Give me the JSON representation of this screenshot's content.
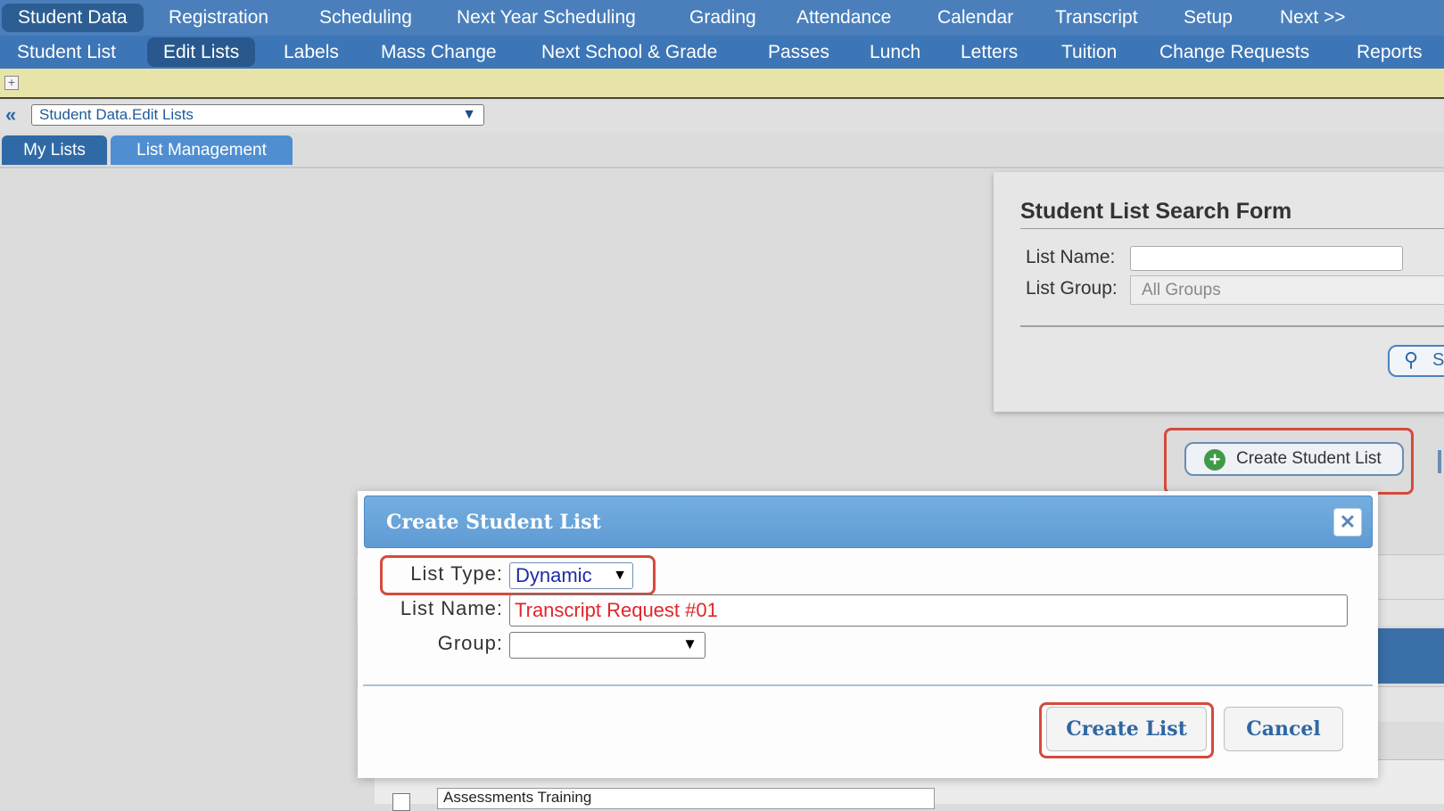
{
  "top_nav": {
    "items": [
      "Student Data",
      "Registration",
      "Scheduling",
      "Next Year Scheduling",
      "Grading",
      "Attendance",
      "Calendar",
      "Transcript",
      "Setup",
      "Next >>"
    ]
  },
  "sub_nav": {
    "items": [
      "Student List",
      "Edit Lists",
      "Labels",
      "Mass Change",
      "Next School & Grade",
      "Passes",
      "Lunch",
      "Letters",
      "Tuition",
      "Change Requests",
      "Reports"
    ]
  },
  "breadcrumb": {
    "icon": "double-chevron-left-icon",
    "select_value": "Student Data.Edit Lists"
  },
  "tabs": [
    "My Lists",
    "List Management"
  ],
  "search_form": {
    "title": "Student List Search Form",
    "list_name_label": "List Name:",
    "list_name_value": "",
    "list_group_label": "List Group:",
    "list_group_value": "All Groups",
    "search_icon": "search-icon",
    "search_label_partial": "S"
  },
  "create_button": {
    "label": "Create Student List",
    "icon": "plus-circle-icon"
  },
  "dialog": {
    "title": "Create Student List",
    "close_icon": "close-icon",
    "list_type_label": "List Type:",
    "list_type_value": "Dynamic",
    "list_name_label": "List Name:",
    "list_name_value": "Transcript Request #01",
    "group_label": "Group:",
    "group_value": "",
    "create_button_label": "Create List",
    "cancel_button_label": "Cancel"
  },
  "background_table": {
    "partial_row_name": "Assessments Training"
  },
  "colors": {
    "nav_blue": "#4a7fbb",
    "nav_dark_blue": "#3d76b7",
    "highlight_red": "#d64a3c",
    "list_name_red": "#e0262b",
    "dialog_header_blue": "#6aa6dc",
    "yellow_bar": "#e8e3a8"
  }
}
